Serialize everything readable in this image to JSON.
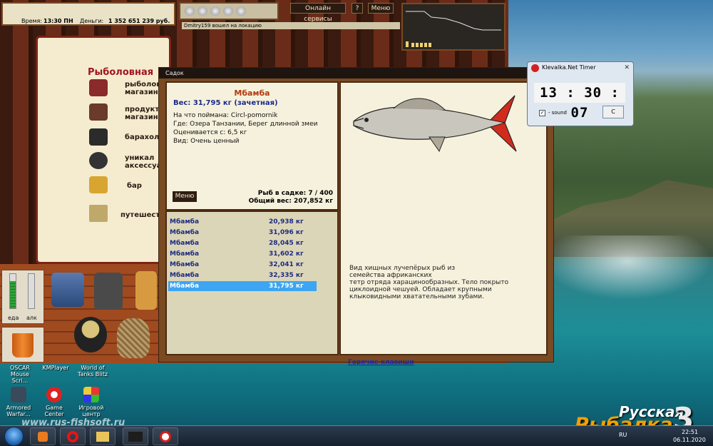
{
  "game": {
    "hud": {
      "time_label": "Время:",
      "time_value": "13:30 ПН",
      "money_label": "Деньги:",
      "money_value": "1 352 651 239 руб."
    },
    "services_button": "Онлайн сервисы",
    "help_button": "?",
    "menu_button": "Меню",
    "login_message": "Dmitry159 вошел на локацию",
    "book": {
      "title": "Рыболовная",
      "items": [
        "рыболовный\nмагазин",
        "продукто\nмагазин",
        "барахол",
        "уникал\nаксессуа",
        "бар",
        "путешест"
      ]
    },
    "inventory": {
      "food_label": "еда",
      "alcohol_label": "алк",
      "food_level_percent": 80,
      "alcohol_level_percent": 0
    }
  },
  "sadok": {
    "title": "Садок",
    "fish_name": "Мбамба",
    "weight_line": "Вес: 31,795 кг (зачетная)",
    "caught_on": "На что поймана: Circl-pomornik",
    "where": "Где: Озера Танзании, Берег длинной змеи",
    "value": "Оценивается с: 6,5 кг",
    "kind": "Вид: Очень ценный",
    "menu_button": "Меню",
    "count_line": "Рыб в садке: 7 / 400",
    "total_weight_line": "Общий вес: 207,852 кг",
    "list": [
      {
        "name": "Мбамба",
        "weight": "20,938 кг"
      },
      {
        "name": "Мбамба",
        "weight": "31,096 кг"
      },
      {
        "name": "Мбамба",
        "weight": "28,045 кг"
      },
      {
        "name": "Мбамба",
        "weight": "31,602 кг"
      },
      {
        "name": "Мбамба",
        "weight": "32,041 кг"
      },
      {
        "name": "Мбамба",
        "weight": "32,335 кг"
      },
      {
        "name": "Мбамба",
        "weight": "31,795 кг"
      }
    ],
    "description": "Вид хищных лучепёрых рыб из\nсемейства африканских\nтетр отряда харацинообразных. Тело покрыто\nциклоидной чешуей. Обладает крупными\nклыковидными хватательными зубами.",
    "hotkeys_link": "Горячие клавиши"
  },
  "timer": {
    "title": "Klevalka.Net Timer",
    "close": "✕",
    "time": "13 : 30 : 07",
    "sound_check": "✓",
    "sound_label": "- sound",
    "c_button": "C"
  },
  "desktop": {
    "icons": [
      {
        "label": "OSCAR\nMouse Scri..."
      },
      {
        "label": "KMPlayer"
      },
      {
        "label": "World of\nTanks Blitz"
      },
      {
        "label": "Armored\nWarfar..."
      },
      {
        "label": "Game Center"
      },
      {
        "label": "Игровой\nцентр"
      }
    ],
    "watermark": "www.rus-fishsoft.ru",
    "brand_line1": "Русская",
    "brand_line2": "Рыбалка",
    "brand_num": "3"
  },
  "taskbar": {
    "lang": "RU",
    "clock": "22:51",
    "date": "06.11.2020"
  },
  "colors": {
    "selected_row": "#3da5f1",
    "fish_name": "#b33a10",
    "weight_text": "#1a2a8a"
  }
}
